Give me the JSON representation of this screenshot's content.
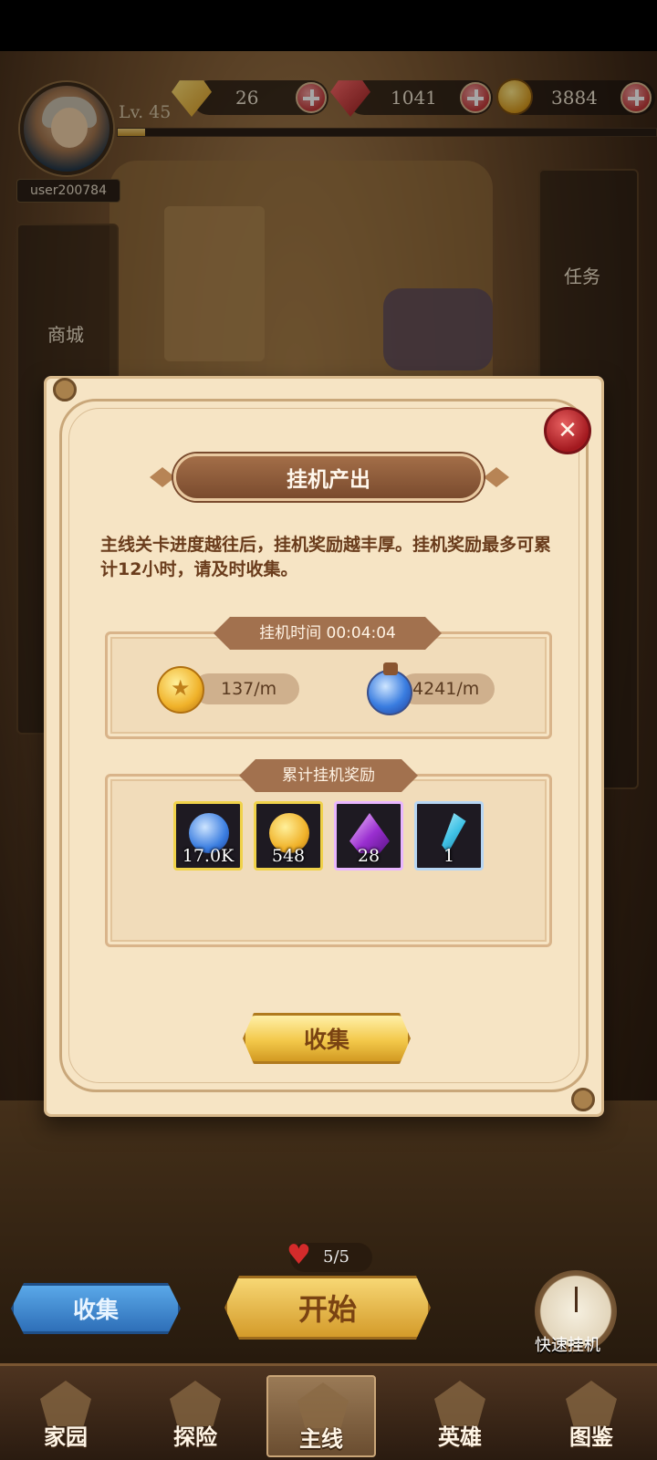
{
  "hud": {
    "level": "Lv. 45",
    "username": "user200784",
    "xp_progress": 0.05,
    "resources": [
      {
        "icon": "yellow-gem-icon",
        "value": "26"
      },
      {
        "icon": "red-gem-icon",
        "value": "1041"
      },
      {
        "icon": "gold-coin-icon",
        "value": "3884"
      }
    ]
  },
  "side_menu": {
    "shop_label": "商城",
    "tasks_label": "任务"
  },
  "modal": {
    "title": "挂机产出",
    "description": "主线关卡进度越往后，挂机奖励越丰厚。挂机奖励最多可累计12小时，请及时收集。",
    "idle_time_label": "挂机时间 00:04:04",
    "rates": [
      {
        "icon": "gold-coin-icon",
        "value": "137/m"
      },
      {
        "icon": "blue-potion-icon",
        "value": "4241/m"
      }
    ],
    "accumulated_label": "累计挂机奖励",
    "rewards": [
      {
        "icon": "blue-potion-icon",
        "quantity": "17.0K",
        "rarity": "gold"
      },
      {
        "icon": "gold-coin-icon",
        "quantity": "548",
        "rarity": "gold"
      },
      {
        "icon": "purple-crystal-icon",
        "quantity": "28",
        "rarity": "purple"
      },
      {
        "icon": "blue-shard-icon",
        "quantity": "1",
        "rarity": "blue"
      }
    ],
    "collect_button": "收集",
    "close_icon": "close-x-icon"
  },
  "bottom": {
    "lives": "5/5",
    "collect_button": "收集",
    "start_button": "开始",
    "quick_idle_label": "快速挂机"
  },
  "navbar": {
    "items": [
      {
        "label": "家园",
        "active": false
      },
      {
        "label": "探险",
        "active": false
      },
      {
        "label": "主线",
        "active": true
      },
      {
        "label": "英雄",
        "active": false
      },
      {
        "label": "图鉴",
        "active": false
      }
    ]
  }
}
